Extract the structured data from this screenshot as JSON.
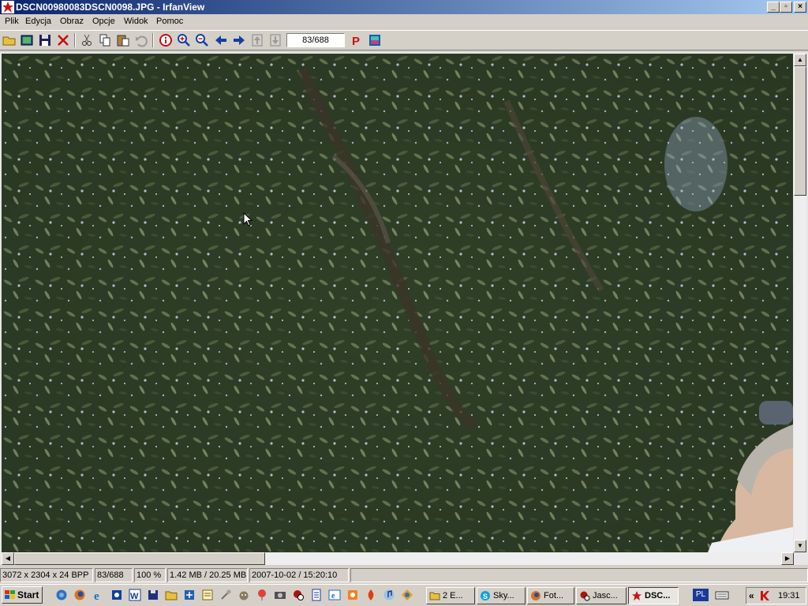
{
  "window": {
    "title": "DSCN00980083DSCN0098.JPG - IrfanView",
    "controls": {
      "minimize": "_",
      "maximize": "▫",
      "close": "×"
    }
  },
  "menu": {
    "items": [
      {
        "label": "Plik"
      },
      {
        "label": "Edycja"
      },
      {
        "label": "Obraz"
      },
      {
        "label": "Opcje"
      },
      {
        "label": "Widok"
      },
      {
        "label": "Pomoc"
      }
    ]
  },
  "toolbar": {
    "page_counter": "83/688",
    "icons": [
      "open-folder-icon",
      "slideshow-icon",
      "save-icon",
      "delete-icon",
      "cut-icon",
      "copy-icon",
      "paste-icon",
      "undo-icon",
      "info-icon",
      "zoom-in-icon",
      "zoom-out-icon",
      "previous-icon",
      "next-icon",
      "first-icon",
      "last-icon",
      "paint-icon",
      "settings-icon"
    ]
  },
  "status": {
    "dimensions": "3072 x 2304 x 24 BPP",
    "index": "83/688",
    "zoom": "100 %",
    "size": "1.42 MB / 20.25 MB",
    "datetime": "2007-10-02 / 15:20:10"
  },
  "taskbar": {
    "start_label": "Start",
    "tasks": [
      {
        "label": "2 E..."
      },
      {
        "label": "Sky..."
      },
      {
        "label": "Fot..."
      },
      {
        "label": "Jasc..."
      },
      {
        "label": "DSC..."
      }
    ],
    "language": "PL",
    "tray_arrows": "«",
    "clock": "19:31"
  },
  "colors": {
    "title_gradient_start": "#0a246a",
    "title_gradient_end": "#a6caf0",
    "chrome": "#d4d0c8"
  }
}
